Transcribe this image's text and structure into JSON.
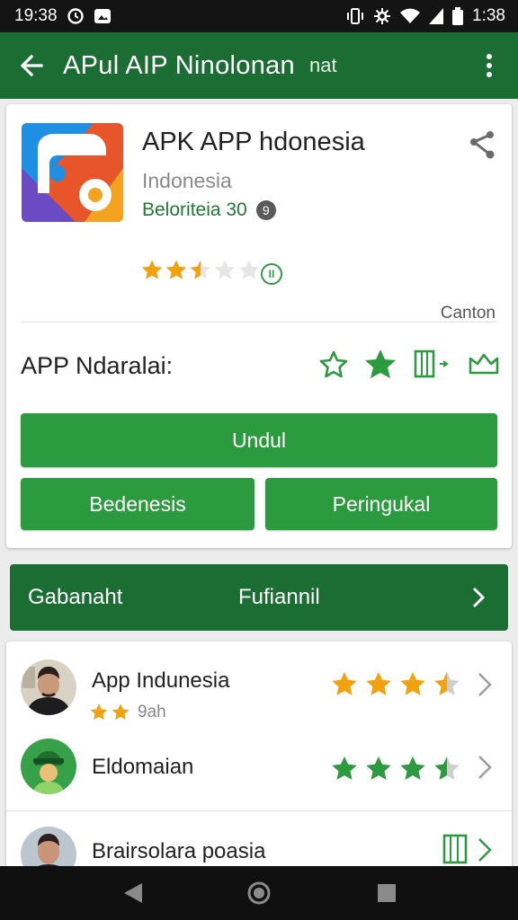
{
  "status_bar": {
    "time_left": "19:38",
    "time_right": "1:38",
    "icons_left": [
      "alarm-icon",
      "notification-icon"
    ],
    "icons_right": [
      "vibrate-icon",
      "settings-icon",
      "wifi-icon",
      "signal-icon",
      "battery-icon"
    ]
  },
  "app_bar": {
    "title": "APul AIP Ninolonan",
    "subtitle": "nat",
    "background": "#1b6d34"
  },
  "app": {
    "name": "APK APP hdonesia",
    "developer": "Indonesia",
    "category": "Beloriteia 30",
    "category_badge": "9",
    "rating": 2.5,
    "rating_info": "II",
    "content_label": "Canton"
  },
  "rate_row": {
    "label": "APP Ndaralai:",
    "icons": [
      "star-outline-icon",
      "star-filled-icon",
      "bookmark-icon",
      "envelope-icon"
    ]
  },
  "buttons": {
    "primary": "Undul",
    "left": "Bedenesis",
    "right": "Peringukal",
    "color": "#2c9a3f"
  },
  "section": {
    "left_label": "Gabanaht",
    "center_label": "Fufiannil"
  },
  "list": [
    {
      "title": "App Indunesia",
      "subtitle": "9ah",
      "sub_rating": 2,
      "rating": 3.5,
      "star_color": "#f2a20f",
      "avatar": "man-avatar"
    },
    {
      "title": "Eldomaian",
      "subtitle": "",
      "sub_rating": 0,
      "rating": 3.5,
      "star_color": "#2c9a3f",
      "avatar": "android-avatar"
    },
    {
      "title": "Brairsolara poasia",
      "subtitle": "",
      "sub_rating": 0,
      "rating": 0,
      "star_color": "#2c9a3f",
      "avatar": "man-avatar"
    }
  ],
  "nav": {
    "buttons": [
      "back-nav-icon",
      "home-nav-icon",
      "recents-nav-icon"
    ]
  }
}
